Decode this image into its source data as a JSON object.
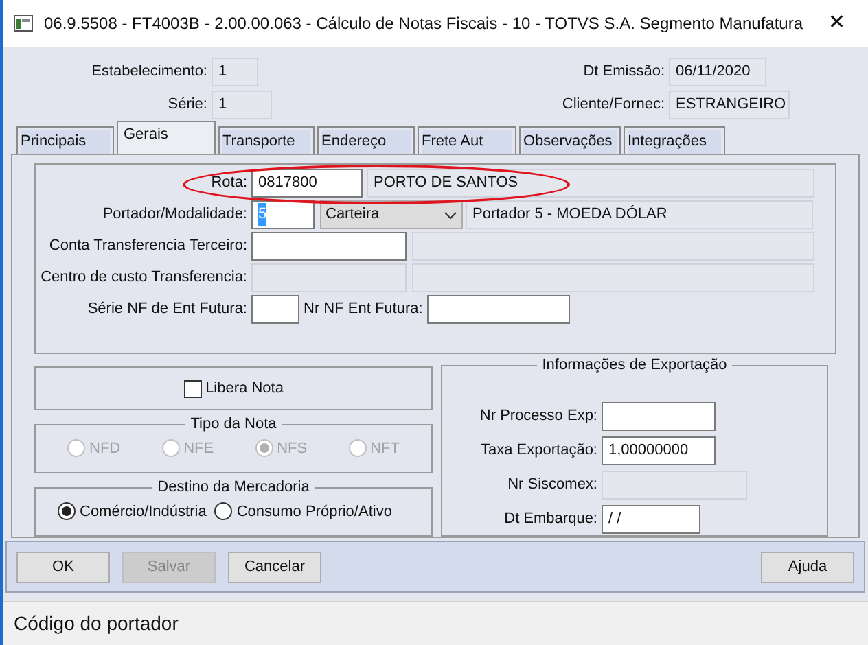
{
  "window": {
    "title": "06.9.5508 - FT4003B - 2.00.00.063 - Cálculo de Notas Fiscais - 10 - TOTVS S.A. Segmento Manufatura",
    "close": "✕"
  },
  "header": {
    "left": [
      {
        "label": "Estabelecimento:",
        "value": "1"
      },
      {
        "label": "Série:",
        "value": "1"
      }
    ],
    "right": [
      {
        "label": "Dt Emissão:",
        "value": "06/11/2020"
      },
      {
        "label": "Cliente/Fornec:",
        "value": "ESTRANGEIRO"
      }
    ]
  },
  "tabs": [
    {
      "label": "Principais",
      "selected": false
    },
    {
      "label": "Gerais",
      "selected": true
    },
    {
      "label": "Transporte",
      "selected": false
    },
    {
      "label": "Endereço",
      "selected": false
    },
    {
      "label": "Frete Aut",
      "selected": false
    },
    {
      "label": "Observações",
      "selected": false
    },
    {
      "label": "Integrações",
      "selected": false
    }
  ],
  "general": {
    "rota": {
      "label": "Rota:",
      "value": "0817800",
      "description": "PORTO DE SANTOS",
      "highlighted": true
    },
    "portador": {
      "label": "Portador/Modalidade:",
      "value": "5",
      "text_selected": true,
      "modalidade": "Carteira",
      "description": "Portador 5 - MOEDA DÓLAR"
    },
    "conta": {
      "label": "Conta Transferencia Terceiro:",
      "disabled": false
    },
    "centro": {
      "label": "Centro de custo Transferencia:",
      "disabled": true
    },
    "serie_nf": {
      "label": "Série NF de Ent Futura:",
      "nr_label": "Nr NF Ent Futura:"
    }
  },
  "libera_nota": {
    "label": "Libera Nota",
    "checked": false
  },
  "tipo_da_nota": {
    "legend": "Tipo da Nota",
    "disabled": true,
    "options": [
      {
        "label": "NFD",
        "selected": false
      },
      {
        "label": "NFE",
        "selected": false
      },
      {
        "label": "NFS",
        "selected": true
      },
      {
        "label": "NFT",
        "selected": false
      }
    ]
  },
  "destino": {
    "legend": "Destino da Mercadoria",
    "disabled": false,
    "options": [
      {
        "label": "Comércio/Indústria",
        "selected": true
      },
      {
        "label": "Consumo Próprio/Ativo",
        "selected": false
      }
    ]
  },
  "exportacao": {
    "legend": "Informações de Exportação",
    "fields": [
      {
        "label": "Nr Processo Exp:",
        "disabled": false
      },
      {
        "label": "Taxa Exportação:",
        "value": "1,00000000",
        "disabled": false
      },
      {
        "label": "Nr Siscomex:",
        "disabled": true
      },
      {
        "label": "Dt Embarque:",
        "value": " / /",
        "disabled": false
      }
    ]
  },
  "buttons": [
    {
      "label": "OK",
      "disabled": false
    },
    {
      "label": "Salvar",
      "disabled": true
    },
    {
      "label": "Cancelar",
      "disabled": false
    },
    {
      "label": "Ajuda",
      "disabled": false
    }
  ],
  "status_bar": "Código do portador"
}
